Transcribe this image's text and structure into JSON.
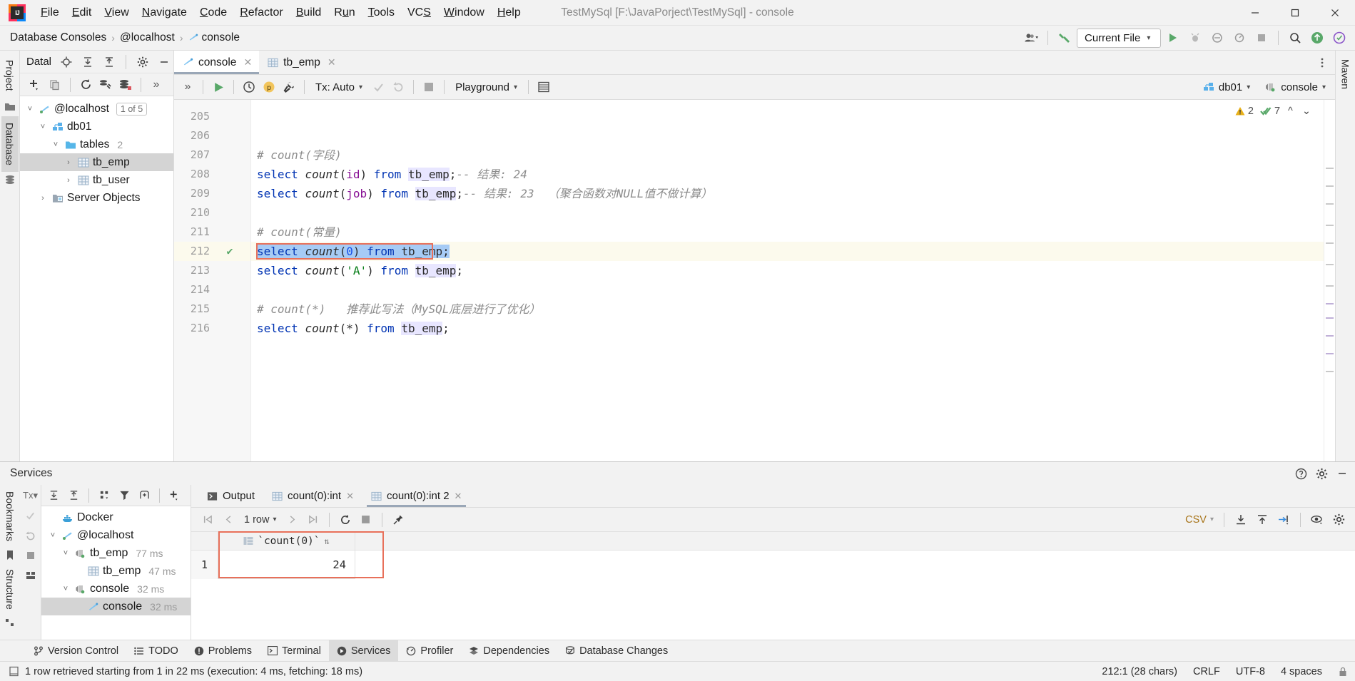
{
  "window": {
    "title": "TestMySql [F:\\JavaPorject\\TestMySql] - console",
    "minimize": "—",
    "maximize": "☐",
    "close": "✕"
  },
  "menubar": {
    "items": [
      "File",
      "Edit",
      "View",
      "Navigate",
      "Code",
      "Refactor",
      "Build",
      "Run",
      "Tools",
      "VCS",
      "Window",
      "Help"
    ]
  },
  "breadcrumb": {
    "items": [
      "Database Consoles",
      "@localhost",
      "console"
    ],
    "separator": "›"
  },
  "nav_right": {
    "run_config": "Current File",
    "caret": "▾"
  },
  "left_rail": {
    "tabs": [
      "Project",
      "Database"
    ]
  },
  "database_panel": {
    "title": "Datal",
    "tree": [
      {
        "label": "@localhost",
        "badge": "1 of 5",
        "indent": 0,
        "arrow": "˅",
        "icon": "datasource-icon",
        "selected": false,
        "count": ""
      },
      {
        "label": "db01",
        "badge": "",
        "indent": 1,
        "arrow": "˅",
        "icon": "database-icon",
        "selected": false,
        "count": ""
      },
      {
        "label": "tables",
        "badge": "",
        "indent": 2,
        "arrow": "˅",
        "icon": "folder-icon",
        "selected": false,
        "count": "2"
      },
      {
        "label": "tb_emp",
        "badge": "",
        "indent": 3,
        "arrow": "›",
        "icon": "table-icon",
        "selected": true,
        "count": ""
      },
      {
        "label": "tb_user",
        "badge": "",
        "indent": 3,
        "arrow": "›",
        "icon": "table-icon",
        "selected": false,
        "count": ""
      },
      {
        "label": "Server Objects",
        "badge": "",
        "indent": 1,
        "arrow": "›",
        "icon": "server-objects-icon",
        "selected": false,
        "count": ""
      }
    ]
  },
  "editor_tabs": [
    {
      "label": "console",
      "icon": "console-icon",
      "active": true
    },
    {
      "label": "tb_emp",
      "icon": "table-icon",
      "active": false
    }
  ],
  "run_toolbar": {
    "tx_label": "Tx: Auto",
    "schema_label": "Playground",
    "datasource": "db01",
    "session": "console"
  },
  "inspections": {
    "warning_count": "2",
    "ok_count": "7",
    "up": "⌃",
    "down": "˅"
  },
  "editor": {
    "first_line": 205,
    "lines": [
      {
        "n": 205,
        "tokens": [],
        "marker": "",
        "highlight": false
      },
      {
        "n": 206,
        "tokens": [],
        "marker": "",
        "highlight": false
      },
      {
        "n": 207,
        "tokens": [
          {
            "t": "# count(字段)",
            "c": "cmt"
          }
        ],
        "marker": "",
        "highlight": false
      },
      {
        "n": 208,
        "tokens": [
          {
            "t": "select ",
            "c": "kw"
          },
          {
            "t": "count",
            "c": "fn"
          },
          {
            "t": "(",
            "c": ""
          },
          {
            "t": "id",
            "c": "param"
          },
          {
            "t": ") ",
            "c": ""
          },
          {
            "t": "from ",
            "c": "kw"
          },
          {
            "t": "tb_emp",
            "c": "tbl"
          },
          {
            "t": ";",
            "c": ""
          },
          {
            "t": "-- 结果: 24",
            "c": "cmt"
          }
        ],
        "marker": "",
        "highlight": false
      },
      {
        "n": 209,
        "tokens": [
          {
            "t": "select ",
            "c": "kw"
          },
          {
            "t": "count",
            "c": "fn"
          },
          {
            "t": "(",
            "c": ""
          },
          {
            "t": "job",
            "c": "param"
          },
          {
            "t": ") ",
            "c": ""
          },
          {
            "t": "from ",
            "c": "kw"
          },
          {
            "t": "tb_emp",
            "c": "tbl"
          },
          {
            "t": ";",
            "c": ""
          },
          {
            "t": "-- 结果: 23  （聚合函数对NULL值不做计算）",
            "c": "cmt"
          }
        ],
        "marker": "",
        "highlight": false
      },
      {
        "n": 210,
        "tokens": [],
        "marker": "",
        "highlight": false
      },
      {
        "n": 211,
        "tokens": [
          {
            "t": "# count(常量)",
            "c": "cmt"
          }
        ],
        "marker": "",
        "highlight": false
      },
      {
        "n": 212,
        "tokens": [
          {
            "t": "select ",
            "c": "kw selhl"
          },
          {
            "t": "count",
            "c": "fn selhl"
          },
          {
            "t": "(",
            "c": "selhl"
          },
          {
            "t": "0",
            "c": "num0 selhl"
          },
          {
            "t": ") ",
            "c": "selhl"
          },
          {
            "t": "from ",
            "c": "kw selhl"
          },
          {
            "t": "tb_emp",
            "c": "selhl"
          },
          {
            "t": ";",
            "c": "selhl"
          }
        ],
        "marker": "✔",
        "highlight": true
      },
      {
        "n": 213,
        "tokens": [
          {
            "t": "select ",
            "c": "kw"
          },
          {
            "t": "count",
            "c": "fn"
          },
          {
            "t": "(",
            "c": ""
          },
          {
            "t": "'A'",
            "c": "str"
          },
          {
            "t": ") ",
            "c": ""
          },
          {
            "t": "from ",
            "c": "kw"
          },
          {
            "t": "tb_emp",
            "c": "tbl"
          },
          {
            "t": ";",
            "c": ""
          }
        ],
        "marker": "",
        "highlight": false
      },
      {
        "n": 214,
        "tokens": [],
        "marker": "",
        "highlight": false
      },
      {
        "n": 215,
        "tokens": [
          {
            "t": "# count(*)   推荐此写法（MySQL底层进行了优化）",
            "c": "cmt"
          }
        ],
        "marker": "",
        "highlight": false
      },
      {
        "n": 216,
        "tokens": [
          {
            "t": "select ",
            "c": "kw"
          },
          {
            "t": "count",
            "c": "fn"
          },
          {
            "t": "(*) ",
            "c": ""
          },
          {
            "t": "from ",
            "c": "kw"
          },
          {
            "t": "tb_emp",
            "c": "tbl"
          },
          {
            "t": ";",
            "c": ""
          }
        ],
        "marker": "",
        "highlight": false
      }
    ]
  },
  "right_rail": {
    "tabs": [
      "Maven"
    ]
  },
  "services": {
    "title": "Services",
    "tree": [
      {
        "label": "Docker",
        "time": "",
        "indent": 0,
        "arrow": "",
        "icon": "docker-icon",
        "selected": false
      },
      {
        "label": "@localhost",
        "time": "",
        "indent": 0,
        "arrow": "˅",
        "icon": "datasource-icon",
        "selected": false
      },
      {
        "label": "tb_emp",
        "time": "77 ms",
        "indent": 1,
        "arrow": "˅",
        "icon": "session-icon",
        "selected": false
      },
      {
        "label": "tb_emp",
        "time": "47 ms",
        "indent": 2,
        "arrow": "",
        "icon": "table-icon",
        "selected": false
      },
      {
        "label": "console",
        "time": "32 ms",
        "indent": 1,
        "arrow": "˅",
        "icon": "session-icon",
        "selected": false
      },
      {
        "label": "console",
        "time": "32 ms",
        "indent": 2,
        "arrow": "",
        "icon": "console-icon",
        "selected": true
      }
    ],
    "tabs": [
      {
        "label": "Output",
        "icon": "output-icon",
        "closable": false,
        "active": false
      },
      {
        "label": "count(0):int",
        "icon": "table-icon",
        "closable": true,
        "active": false
      },
      {
        "label": "count(0):int 2",
        "icon": "table-icon",
        "closable": true,
        "active": true
      }
    ],
    "grid_toolbar": {
      "first": "⏮",
      "prev": "‹",
      "rowcount": "1 row",
      "next": "›",
      "last": "⏭",
      "format": "CSV"
    },
    "result": {
      "column": "`count(0)`",
      "rows": [
        {
          "num": "1",
          "value": "24"
        }
      ]
    }
  },
  "tool_windows": [
    {
      "label": "Version Control",
      "icon": "branch-icon",
      "active": false
    },
    {
      "label": "TODO",
      "icon": "todo-icon",
      "active": false
    },
    {
      "label": "Problems",
      "icon": "problems-icon",
      "active": false
    },
    {
      "label": "Terminal",
      "icon": "terminal-icon",
      "active": false
    },
    {
      "label": "Services",
      "icon": "services-icon",
      "active": true
    },
    {
      "label": "Profiler",
      "icon": "profiler-icon",
      "active": false
    },
    {
      "label": "Dependencies",
      "icon": "dependencies-icon",
      "active": false
    },
    {
      "label": "Database Changes",
      "icon": "db-changes-icon",
      "active": false
    }
  ],
  "statusbar": {
    "message": "1 row retrieved starting from 1 in 22 ms (execution: 4 ms, fetching: 18 ms)",
    "caret": "212:1 (28 chars)",
    "line_sep": "CRLF",
    "encoding": "UTF-8",
    "indent": "4 spaces"
  },
  "colors": {
    "accent_blue": "#4a86c8",
    "keyword": "#0033b3",
    "string": "#067d17",
    "comment": "#8c8c8c",
    "selection": "#a6cbf5",
    "red_highlight": "#e8705a",
    "green_ok": "#59a869",
    "warn_yellow": "#e8b019",
    "tab_underline": "#9aa7b7"
  }
}
